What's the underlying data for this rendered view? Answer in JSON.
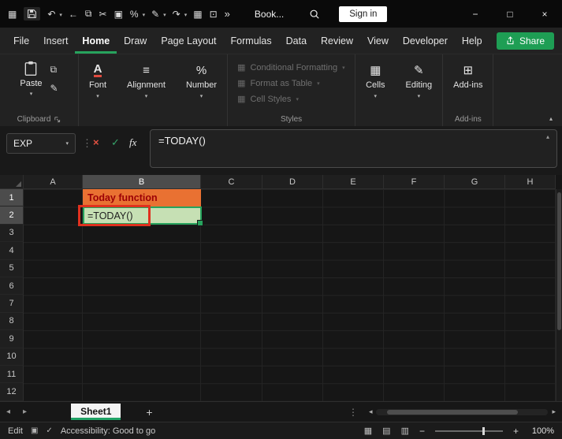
{
  "colors": {
    "accent_green": "#21A366",
    "share_green": "#1E9E54",
    "selection_green": "#27A35D",
    "annotation_red": "#E0301E",
    "cell_b1_fill": "#E97132",
    "cell_b1_text": "#9C0006",
    "cell_b2_fill": "#C6E0B4",
    "cell_b2_text": "#202020"
  },
  "titlebar": {
    "title": "Book...",
    "signin_label": "Sign in",
    "icons": {
      "menu": "▦",
      "undo": "↶",
      "back": "←",
      "copy": "⧉",
      "cut": "✂",
      "image": "▣",
      "percent": "%",
      "pen": "✎",
      "redo": "↷",
      "table": "▦",
      "camera": "⊡",
      "more": "»",
      "chevron": "▾"
    },
    "window": {
      "minimize": "−",
      "maximize": "□",
      "close": "×"
    }
  },
  "menu": {
    "items": [
      "File",
      "Insert",
      "Home",
      "Draw",
      "Page Layout",
      "Formulas",
      "Data",
      "Review",
      "View",
      "Developer",
      "Help"
    ],
    "active": "Home",
    "share_label": "Share"
  },
  "ribbon": {
    "paste_label": "Paste",
    "clipboard_group_label": "Clipboard",
    "font_label": "Font",
    "font_icon": "A",
    "alignment_label": "Alignment",
    "alignment_icon": "≡",
    "number_label": "Number",
    "number_icon": "%",
    "styles": {
      "conditional_formatting": "Conditional Formatting",
      "format_as_table": "Format as Table",
      "cell_styles": "Cell Styles",
      "group_label": "Styles",
      "row_icon": "▦"
    },
    "cells_label": "Cells",
    "cells_icon": "▦",
    "editing_label": "Editing",
    "editing_icon": "✎",
    "addins_label": "Add-ins",
    "addins_icon": "⊞",
    "addins_group_label": "Add-ins",
    "copy_icon": "⧉",
    "painter_icon": "✎",
    "chevron": "▾",
    "collapse_chevron": "▴"
  },
  "formula_bar": {
    "name_box": "EXP",
    "name_chevron": "▾",
    "cancel": "×",
    "enter": "✓",
    "fx": "fx",
    "formula": "=TODAY()",
    "collapse_chevron": "▴",
    "dots": "⋮"
  },
  "grid": {
    "columns": [
      "A",
      "B",
      "C",
      "D",
      "E",
      "F",
      "G",
      "H"
    ],
    "rows": [
      "1",
      "2",
      "3",
      "4",
      "5",
      "6",
      "7",
      "8",
      "9",
      "10",
      "11",
      "12"
    ],
    "cells": {
      "B1": {
        "text": "Today function",
        "style": "background:#E97132;color:#9C0006;font-weight:700"
      },
      "B2": {
        "text": "=TODAY()",
        "style": "background:#C6E0B4;color:#202020"
      }
    }
  },
  "sheet_tabs": {
    "prev": "◂",
    "next": "▸",
    "tabs": [
      {
        "label": "Sheet1"
      }
    ],
    "add": "+",
    "menu_dots": "⋮",
    "scroll_left": "◂",
    "scroll_right": "▸"
  },
  "status_bar": {
    "mode": "Edit",
    "macro_icon": "▣",
    "check_icon": "✓",
    "accessibility": "Accessibility: Good to go",
    "view_icons": [
      "▦",
      "▤",
      "▥"
    ],
    "zoom_out": "−",
    "zoom_in": "+",
    "zoom_level": "100%"
  }
}
